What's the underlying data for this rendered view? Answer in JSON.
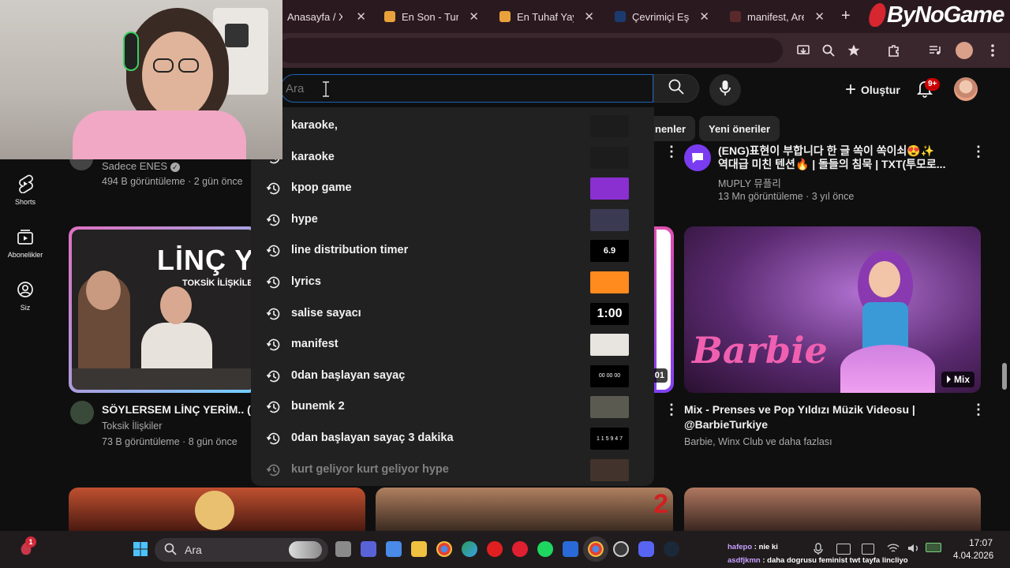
{
  "browser": {
    "tabs": [
      {
        "label": "Anasayfa / X",
        "fav_color": "#000000"
      },
      {
        "label": "En Son - Turnu",
        "fav_color": "#e9a23b"
      },
      {
        "label": "En Tuhaf Yayın",
        "fav_color": "#e9a23b"
      },
      {
        "label": "Çevrimiçi Eşli",
        "fav_color": "#1b3b6f"
      },
      {
        "label": "manifest, Aren",
        "fav_color": "#5a2a2a"
      }
    ],
    "new_tab": "+",
    "close_glyph": "✕",
    "brand": "ByNoGame"
  },
  "youtube": {
    "search": {
      "placeholder": "Ara",
      "value": ""
    },
    "create_label": "Oluştur",
    "notifications_badge": "9+",
    "chips": [
      "nenler",
      "Yeni öneriler"
    ],
    "nav": [
      {
        "label": "Shorts",
        "icon": "shorts-icon"
      },
      {
        "label": "Abonelikler",
        "icon": "subscriptions-icon"
      },
      {
        "label": "Siz",
        "icon": "you-icon"
      }
    ],
    "suggestions": [
      {
        "text": "karaoke,",
        "thumb_bg": "#1c1c1c",
        "thumb_text": ""
      },
      {
        "text": "karaoke",
        "thumb_bg": "#1c1c1c",
        "thumb_text": ""
      },
      {
        "text": "kpop game",
        "thumb_bg": "#8a2fd0",
        "thumb_text": ""
      },
      {
        "text": "hype",
        "thumb_bg": "#3a3a52",
        "thumb_text": ""
      },
      {
        "text": "line distribution timer",
        "thumb_bg": "#000000",
        "thumb_text": "6.9"
      },
      {
        "text": "lyrics",
        "thumb_bg": "#ff8a1e",
        "thumb_text": ""
      },
      {
        "text": "salise sayacı",
        "thumb_bg": "#000000",
        "thumb_text": "1:00"
      },
      {
        "text": "manifest",
        "thumb_bg": "#e8e4e0",
        "thumb_text": ""
      },
      {
        "text": "0dan başlayan sayaç",
        "thumb_bg": "#000000",
        "thumb_text": "00 00 00"
      },
      {
        "text": "bunemk 2",
        "thumb_bg": "#5a5a50",
        "thumb_text": ""
      },
      {
        "text": "0dan başlayan sayaç 3 dakika",
        "thumb_bg": "#000000",
        "thumb_text": "1 1 5 9 4 7"
      },
      {
        "text": "kurt geliyor kurt geliyor hype",
        "thumb_bg": "#6a4a3a",
        "thumb_text": ""
      }
    ],
    "videos": {
      "top_left": {
        "channel": "Sadece ENES",
        "meta": "494 B görüntüleme · 2 gün önce"
      },
      "top_right": {
        "title_line1": "(ENG)표현이 부합니다  한 글 쏙이 쏙이쇠😍✨",
        "title_line2": "역대급 미친 텐션🔥 | 돌들의 침묵 | TXT(투모로...",
        "channel": "MUPLY 뮤플리",
        "meta": "13 Mn görüntüleme · 3 yıl önce"
      },
      "mid_left": {
        "thumb_text_big": "LİNÇ YE",
        "thumb_text_small": "TOKSİK İLİŞKİLER",
        "title": "SÖYLERSEM LİNÇ YERİM.. (k",
        "channel": "Toksik İlişkiler",
        "meta": "73 B görüntüleme · 8 gün önce"
      },
      "mid_middle": {
        "duration_tail": "01"
      },
      "mid_right": {
        "thumb_logo": "Barbie",
        "badge": "Mix",
        "title_line1": "Mix - Prenses ve Pop Yıldızı Müzik Videosu |",
        "title_line2": "@BarbieTurkiye",
        "channel": "Barbie, Winx Club ve daha fazlası"
      },
      "bottom_middle": {
        "thumb_number": "2"
      }
    }
  },
  "taskbar": {
    "search_placeholder": "Ara",
    "start_badge": "1",
    "chat": [
      {
        "user": "hafepo",
        "text": "nie ki"
      },
      {
        "user": "asdfjkmn",
        "text": "daha dogrusu feminist twt tayfa lincliyo"
      }
    ],
    "time": "17:07",
    "date": "4.04.2026"
  }
}
